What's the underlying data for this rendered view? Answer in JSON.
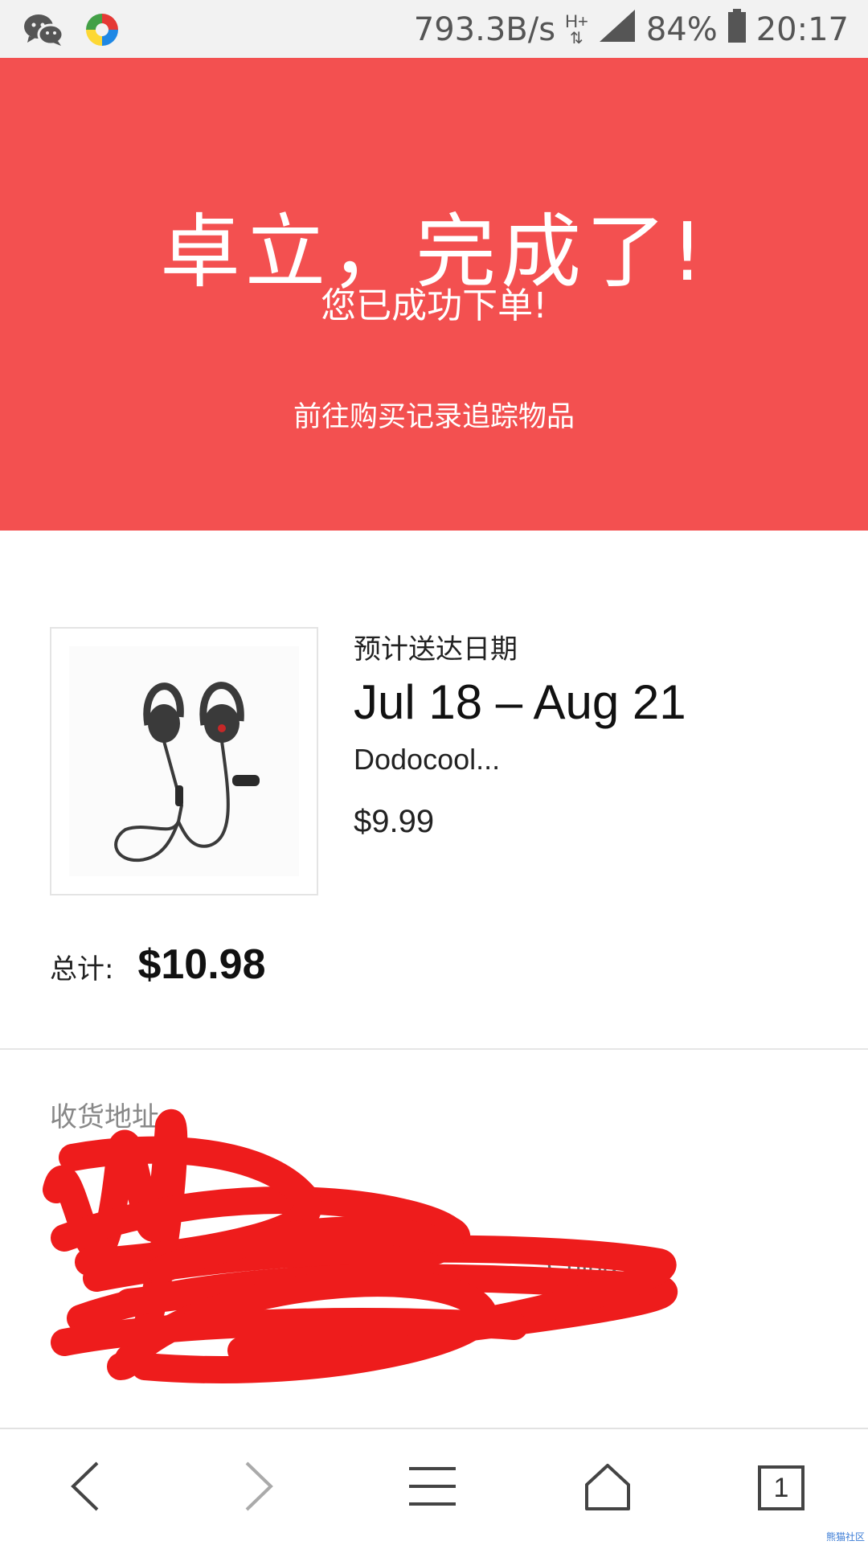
{
  "status_bar": {
    "network_speed": "793.3B/s",
    "network_type": "H+",
    "battery": "84%",
    "time": "20:17",
    "icons": [
      "wechat-icon",
      "app-icon",
      "signal-icon",
      "battery-icon"
    ]
  },
  "hero": {
    "title": "卓立，完成了!",
    "subtitle": "您已成功下单!",
    "track_link": "前往购买记录追踪物品",
    "background_color": "#f35050"
  },
  "order": {
    "eta_label": "预计送达日期",
    "eta_value": "Jul 18 – Aug 21",
    "product_name": "Dodocool...",
    "product_price": "$9.99",
    "total_label": "总计:",
    "total_value": "$10.98"
  },
  "address": {
    "label": "收货地址",
    "visible_fragment": "China"
  },
  "bottom_nav": {
    "tab_count": "1",
    "icons": [
      "back-icon",
      "forward-icon",
      "menu-icon",
      "home-icon",
      "tabs-icon"
    ]
  },
  "watermark": "熊猫社区"
}
